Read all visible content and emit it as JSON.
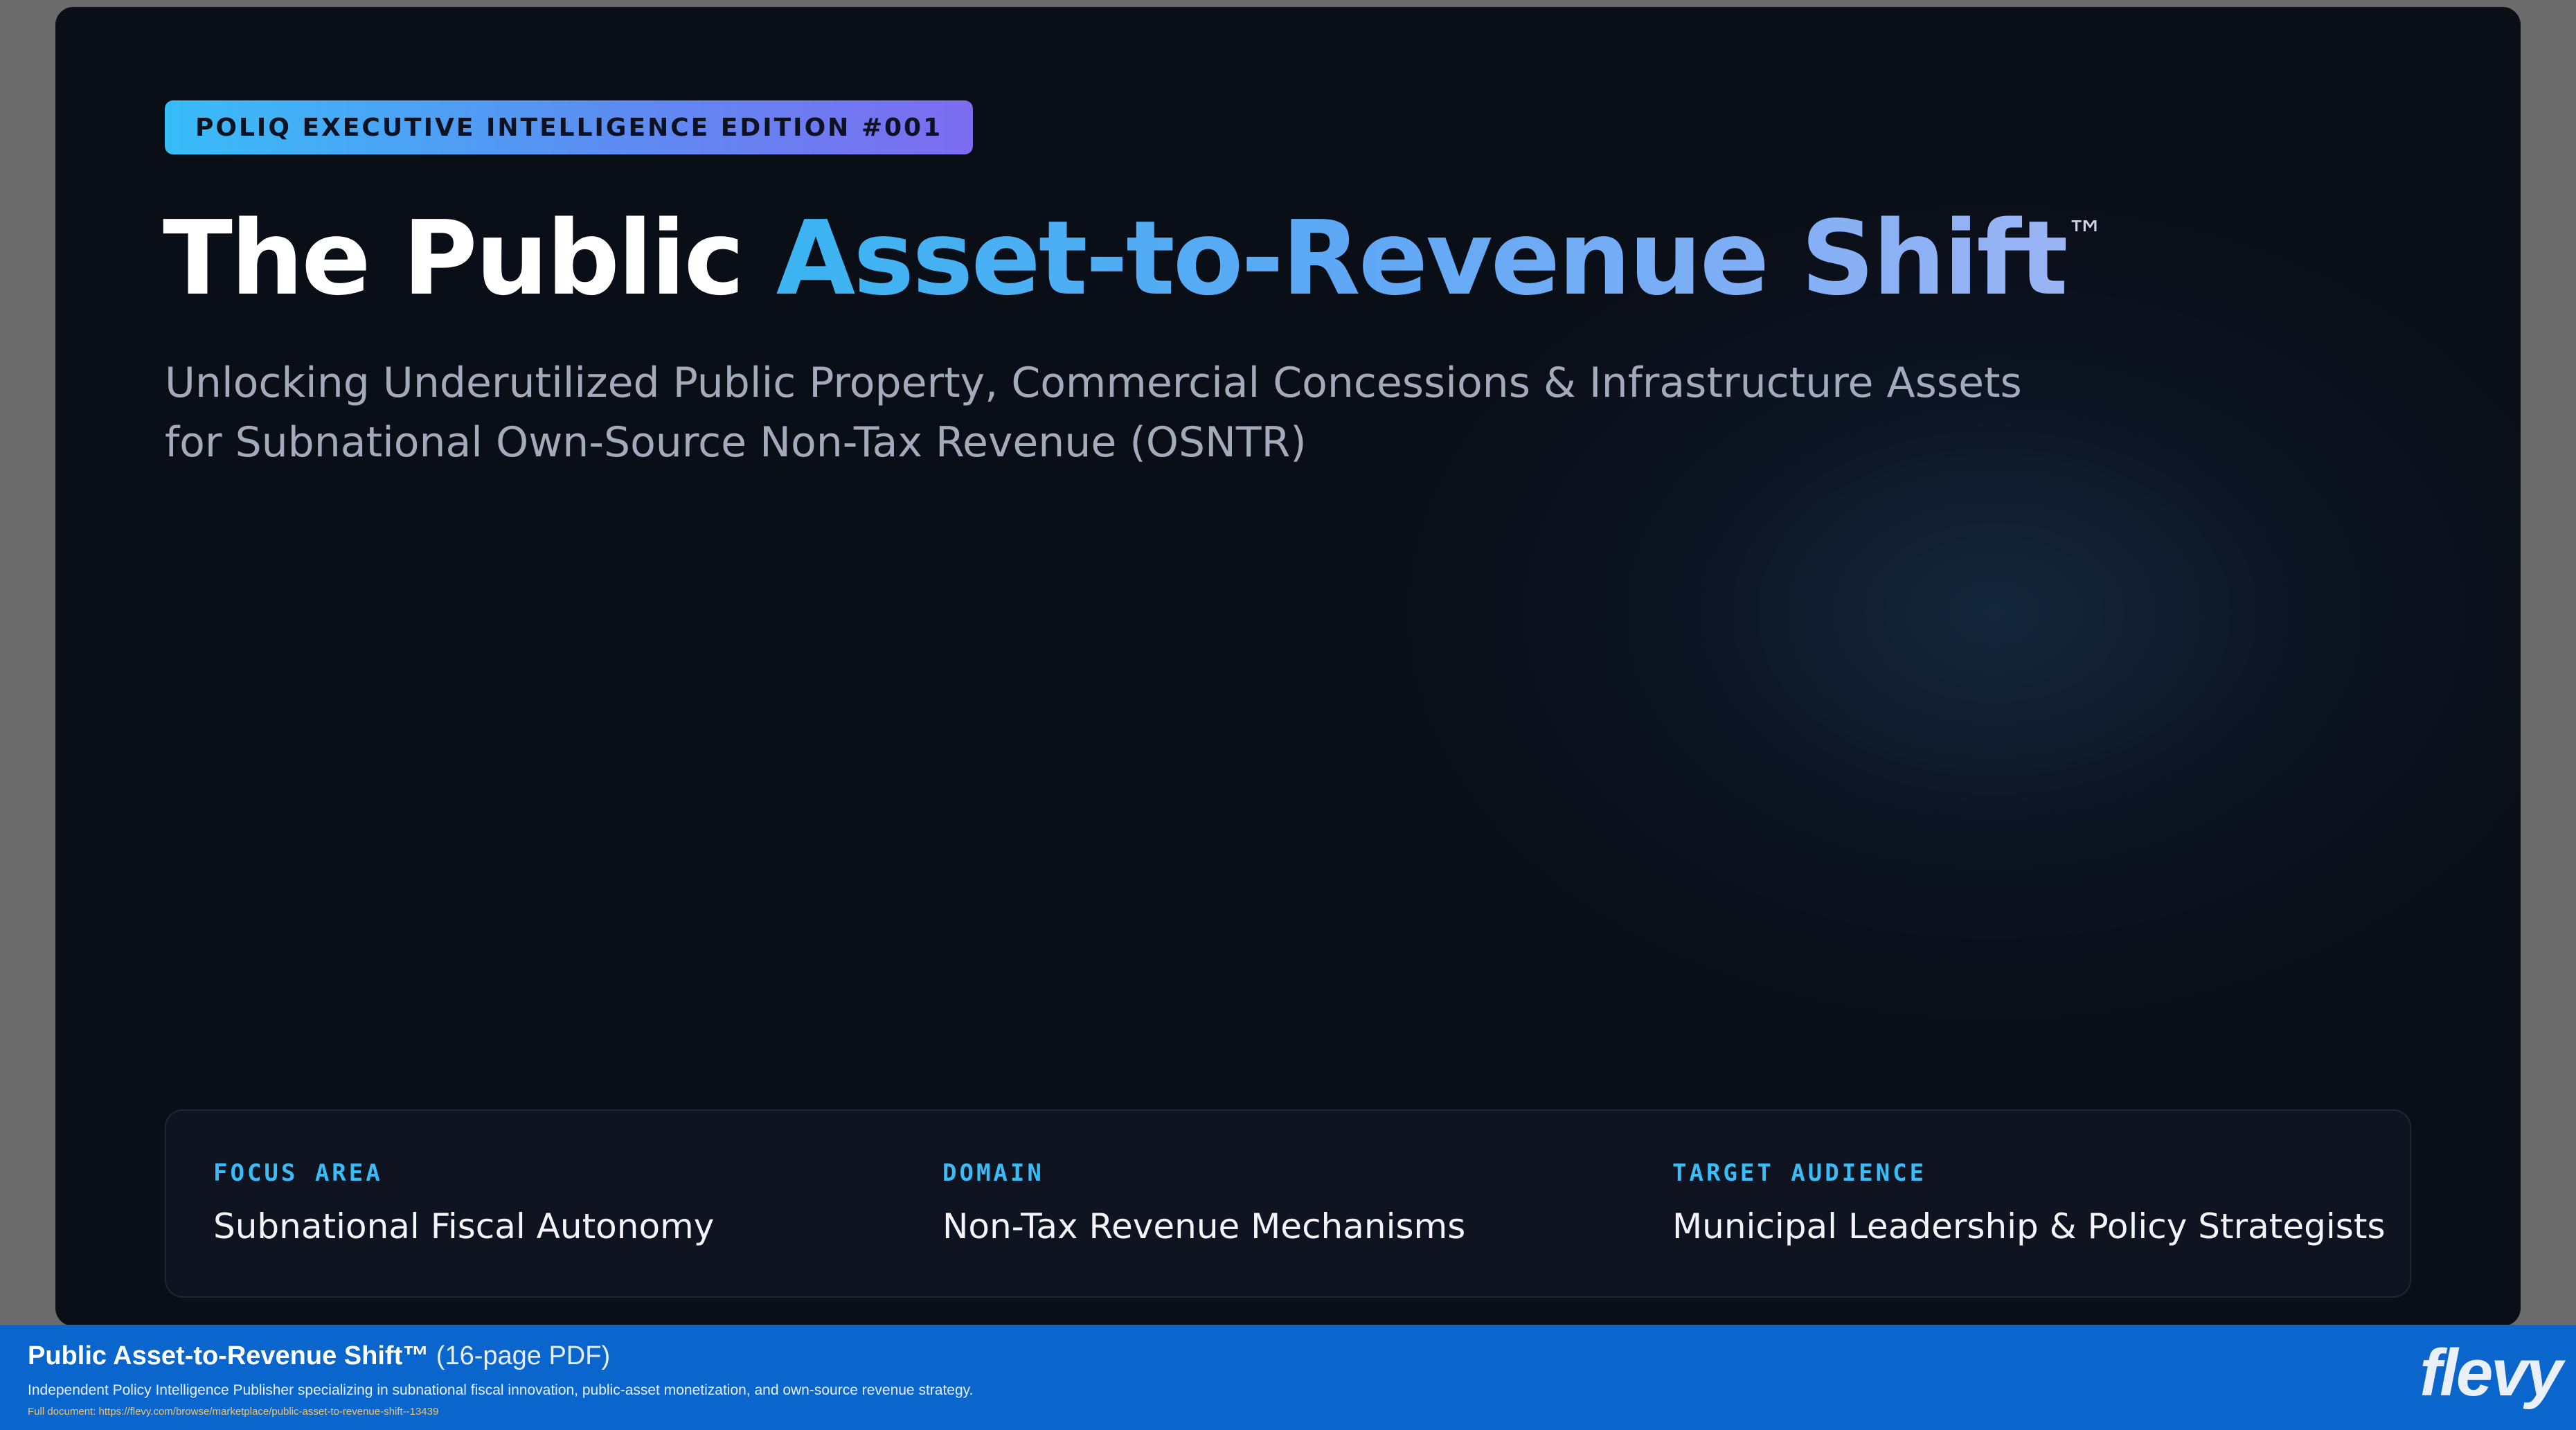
{
  "slide": {
    "badge": "POLIQ EXECUTIVE INTELLIGENCE EDITION #001",
    "title_plain": "The Public ",
    "title_accent": "Asset-to-Revenue Shift",
    "title_mark": "™",
    "subtitle": "Unlocking Underutilized Public Property, Commercial Concessions & Infrastructure Assets for Subnational Own-Source Non-Tax Revenue (OSNTR)",
    "info": [
      {
        "label": "FOCUS AREA",
        "value": "Subnational Fiscal Autonomy"
      },
      {
        "label": "DOMAIN",
        "value": "Non-Tax Revenue Mechanisms"
      },
      {
        "label": "TARGET AUDIENCE",
        "value": "Municipal Leadership & Policy Strategists"
      }
    ]
  },
  "footer": {
    "title": "Public Asset-to-Revenue Shift™",
    "title_suffix": "(16-page PDF)",
    "description": "Independent Policy Intelligence Publisher specializing in subnational fiscal innovation, public-asset monetization, and own-source revenue strategy.",
    "link": "Full document: https://flevy.com/browse/marketplace/public-asset-to-revenue-shift--13439",
    "logo": "flevy"
  },
  "colors": {
    "slide_bg": "#0a0e17",
    "accent_blue": "#38bdf8",
    "accent_violet": "#7c6cf0",
    "footer_bg": "#0a66cc"
  }
}
